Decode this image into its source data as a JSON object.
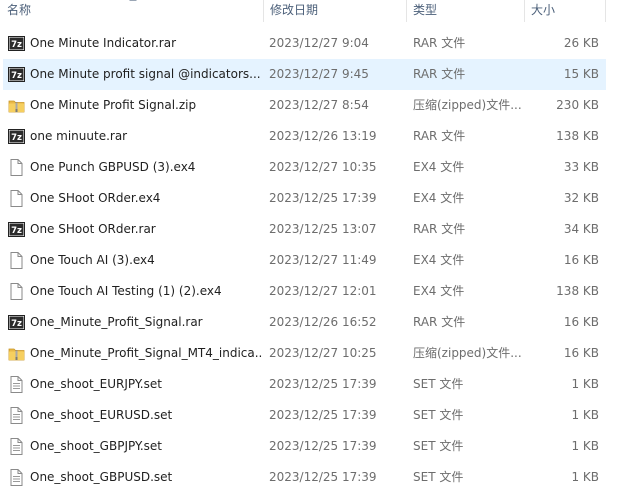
{
  "header": {
    "name": "名称",
    "date": "修改日期",
    "type": "类型",
    "size": "大小"
  },
  "colors": {
    "selected_row": "#e5f3ff",
    "header_text": "#4c607a",
    "secondary_text": "#6d6d6d"
  },
  "files": [
    {
      "name": "One Minute Indicator.rar",
      "date": "2023/12/27 9:04",
      "type": "RAR 文件",
      "size": "26 KB",
      "icon": "rar-7z-icon"
    },
    {
      "name": "One Minute profit signal @indicators...",
      "date": "2023/12/27 9:45",
      "type": "RAR 文件",
      "size": "15 KB",
      "icon": "rar-7z-icon",
      "selected": true
    },
    {
      "name": "One Minute Profit Signal.zip",
      "date": "2023/12/27 8:54",
      "type": "压缩(zipped)文件...",
      "size": "230 KB",
      "icon": "zip-folder-icon"
    },
    {
      "name": "one minuute.rar",
      "date": "2023/12/26 13:19",
      "type": "RAR 文件",
      "size": "138 KB",
      "icon": "rar-7z-icon"
    },
    {
      "name": "One Punch GBPUSD (3).ex4",
      "date": "2023/12/27 10:35",
      "type": "EX4 文件",
      "size": "33 KB",
      "icon": "blank-file-icon"
    },
    {
      "name": "One SHoot ORder.ex4",
      "date": "2023/12/25 17:39",
      "type": "EX4 文件",
      "size": "32 KB",
      "icon": "blank-file-icon"
    },
    {
      "name": "One SHoot ORder.rar",
      "date": "2023/12/25 13:07",
      "type": "RAR 文件",
      "size": "34 KB",
      "icon": "rar-7z-icon"
    },
    {
      "name": "One Touch AI (3).ex4",
      "date": "2023/12/27 11:49",
      "type": "EX4 文件",
      "size": "16 KB",
      "icon": "blank-file-icon"
    },
    {
      "name": "One Touch AI Testing (1) (2).ex4",
      "date": "2023/12/27 12:01",
      "type": "EX4 文件",
      "size": "138 KB",
      "icon": "blank-file-icon"
    },
    {
      "name": "One_Minute_Profit_Signal.rar",
      "date": "2023/12/26 16:52",
      "type": "RAR 文件",
      "size": "16 KB",
      "icon": "rar-7z-icon"
    },
    {
      "name": "One_Minute_Profit_Signal_MT4_indica...",
      "date": "2023/12/27 10:25",
      "type": "压缩(zipped)文件...",
      "size": "16 KB",
      "icon": "zip-folder-icon"
    },
    {
      "name": "One_shoot_EURJPY.set",
      "date": "2023/12/25 17:39",
      "type": "SET 文件",
      "size": "1 KB",
      "icon": "text-file-icon"
    },
    {
      "name": "One_shoot_EURUSD.set",
      "date": "2023/12/25 17:39",
      "type": "SET 文件",
      "size": "1 KB",
      "icon": "text-file-icon"
    },
    {
      "name": "One_shoot_GBPJPY.set",
      "date": "2023/12/25 17:39",
      "type": "SET 文件",
      "size": "1 KB",
      "icon": "text-file-icon"
    },
    {
      "name": "One_shoot_GBPUSD.set",
      "date": "2023/12/25 17:39",
      "type": "SET 文件",
      "size": "1 KB",
      "icon": "text-file-icon"
    }
  ]
}
